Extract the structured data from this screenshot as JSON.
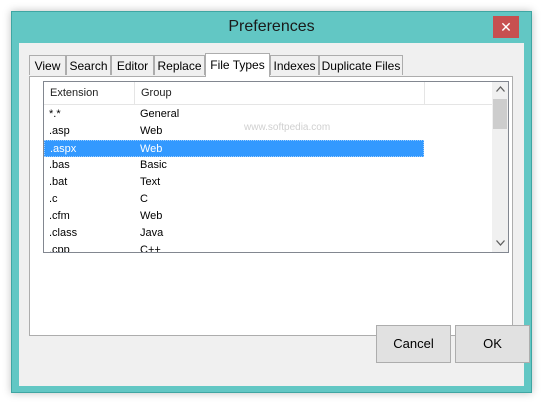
{
  "window": {
    "title": "Preferences",
    "close_glyph": "✕"
  },
  "tabs": [
    {
      "label": "View"
    },
    {
      "label": "Search"
    },
    {
      "label": "Editor"
    },
    {
      "label": "Replace"
    },
    {
      "label": "File Types"
    },
    {
      "label": "Indexes"
    },
    {
      "label": "Duplicate Files"
    }
  ],
  "list": {
    "columns": [
      "Extension",
      "Group"
    ],
    "rows": [
      {
        "ext": "*.*",
        "group": "General"
      },
      {
        "ext": ".asp",
        "group": "Web"
      },
      {
        "ext": ".aspx",
        "group": "Web",
        "selected": true
      },
      {
        "ext": ".bas",
        "group": "Basic"
      },
      {
        "ext": ".bat",
        "group": "Text"
      },
      {
        "ext": ".c",
        "group": "C"
      },
      {
        "ext": ".cfm",
        "group": "Web"
      },
      {
        "ext": ".class",
        "group": "Java"
      },
      {
        "ext": ".cpp",
        "group": "C++"
      }
    ]
  },
  "watermark": "www.softpedia.com",
  "buttons": {
    "cancel": "Cancel",
    "ok": "OK"
  },
  "colors": {
    "frame": "#62c7c4",
    "selection": "#3399ff",
    "close": "#c75050"
  }
}
